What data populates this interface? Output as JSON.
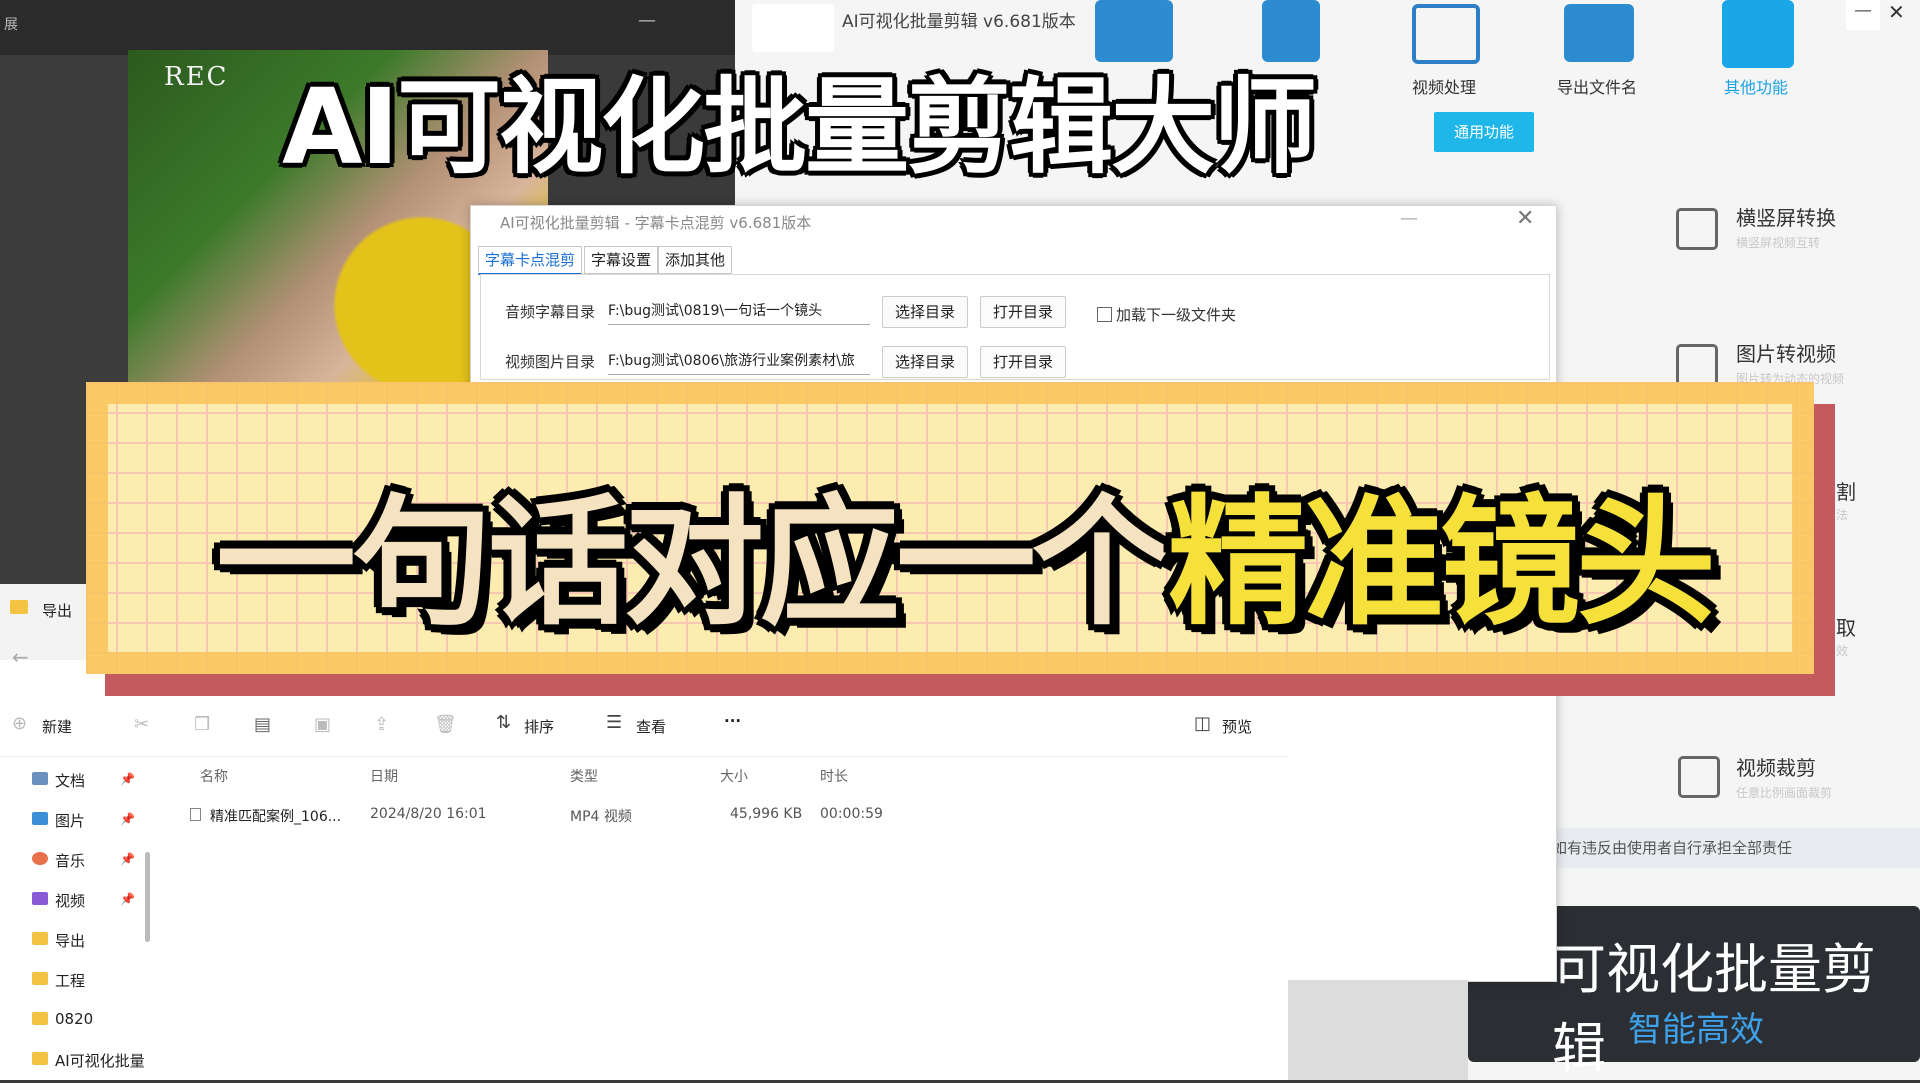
{
  "top_left_window": {
    "title": "展",
    "min": "—"
  },
  "video": {
    "rec_label": "REC"
  },
  "app": {
    "title": "AI可视化批量剪辑 v6.681版本",
    "toolbar": [
      {
        "label": "视频处理",
        "icon": "sliders-icon"
      },
      {
        "label": "导出文件名",
        "icon": "folder-export-icon"
      },
      {
        "label": "其他功能",
        "icon": "grid-apps-icon",
        "active": true
      }
    ],
    "window_controls": {
      "min": "—",
      "close": "✕"
    },
    "common_button": "通用功能",
    "features": [
      {
        "title": "横竖屏转换",
        "sub": "横竖屏视频互转",
        "icon": "rotate-screen-icon"
      },
      {
        "title": "图片转视频",
        "sub": "图片转为动态的视频",
        "icon": "image-to-video-icon"
      },
      {
        "title": "割",
        "sub": "法",
        "icon": ""
      },
      {
        "title": "取",
        "sub": "效",
        "icon": ""
      },
      {
        "title": "视频裁剪",
        "sub": "任意比例画面裁剪",
        "icon": "crop-icon"
      }
    ],
    "disclaimer": "如有违反由使用者自行承担全部责任",
    "promo": {
      "line1": "可视化批量剪辑",
      "line2": "智能高效"
    }
  },
  "dialog": {
    "title": "AI可视化批量剪辑 - 字幕卡点混剪  v6.681版本",
    "min": "—",
    "close": "✕",
    "tabs": [
      "字幕卡点混剪",
      "字幕设置",
      "添加其他"
    ],
    "rows": [
      {
        "label": "音频字幕目录",
        "value": "F:\\bug测试\\0819\\一句话一个镜头",
        "btn_select": "选择目录",
        "btn_open": "打开目录"
      },
      {
        "label": "视频图片目录",
        "value": "F:\\bug测试\\0806\\旅游行业案例素材\\旅",
        "btn_select": "选择目录",
        "btn_open": "打开目录"
      }
    ],
    "checkbox_label": "加载下一级文件夹"
  },
  "headline": "AI可视化批量剪辑大师",
  "banner": {
    "part_a": "一句话对应一个",
    "part_b": "精准镜头"
  },
  "explorer": {
    "title": "导出",
    "toolbar": {
      "new": "新建",
      "sort": "排序",
      "view": "查看",
      "more": "···",
      "preview": "预览"
    },
    "nav": [
      {
        "label": "文档",
        "color": "#6a8fbf",
        "pin": true
      },
      {
        "label": "图片",
        "color": "#3a8fd6",
        "pin": true
      },
      {
        "label": "音乐",
        "color": "#e8704a",
        "pin": true
      },
      {
        "label": "视频",
        "color": "#8a5ad6",
        "pin": true
      },
      {
        "label": "导出",
        "color": "#f5c342",
        "pin": false
      },
      {
        "label": "工程",
        "color": "#f5c342",
        "pin": false
      },
      {
        "label": "0820",
        "color": "#f5c342",
        "pin": false
      },
      {
        "label": "AI可视化批量",
        "color": "#f5c342",
        "pin": false
      }
    ],
    "columns": [
      "名称",
      "日期",
      "类型",
      "大小",
      "时长"
    ],
    "files": [
      {
        "name": "精准匹配案例_106...",
        "date": "2024/8/20 16:01",
        "type": "MP4 视频",
        "size": "45,996 KB",
        "duration": "00:00:59"
      }
    ]
  }
}
